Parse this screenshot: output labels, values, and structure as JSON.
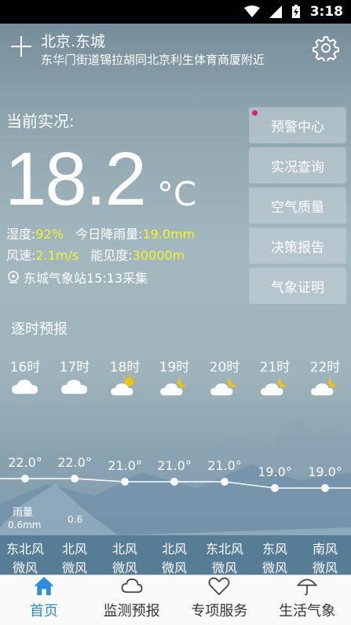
{
  "status_bar": {
    "time": "3:18"
  },
  "header": {
    "city": "北京.东城",
    "address": "东华门街道锡拉胡同北京利生体育商厦附近"
  },
  "current": {
    "label": "当前实况:",
    "temperature": "18.2",
    "unit": "°C",
    "humidity_label": "湿度:",
    "humidity": "92%",
    "rain_label": "今日降雨量:",
    "rain": "19.0mm",
    "wind_label": "风速:",
    "wind": "2.1m/s",
    "visibility_label": "能见度:",
    "visibility": "30000m",
    "station": "东城气象站15:13采集"
  },
  "side_buttons": [
    {
      "label": "预警中心"
    },
    {
      "label": "实况查询"
    },
    {
      "label": "空气质量"
    },
    {
      "label": "决策报告"
    },
    {
      "label": "气象证明"
    }
  ],
  "hourly": {
    "title": "逐时预报",
    "items": [
      {
        "hour": "16时",
        "icon": "cloudy-icon",
        "temp": "22.0°",
        "temp_value": 22.0,
        "wind_dir": "东北风",
        "wind_level": "微风"
      },
      {
        "hour": "17时",
        "icon": "cloudy-icon",
        "temp": "22.0°",
        "temp_value": 22.0,
        "wind_dir": "北风",
        "wind_level": "微风"
      },
      {
        "hour": "18时",
        "icon": "partly-cloudy-day-icon",
        "temp": "21.0°",
        "temp_value": 21.0,
        "wind_dir": "北风",
        "wind_level": "微风"
      },
      {
        "hour": "19时",
        "icon": "partly-cloudy-night-icon",
        "temp": "21.0°",
        "temp_value": 21.0,
        "wind_dir": "北风",
        "wind_level": "微风"
      },
      {
        "hour": "20时",
        "icon": "partly-cloudy-night-icon",
        "temp": "21.0°",
        "temp_value": 21.0,
        "wind_dir": "东北风",
        "wind_level": "微风"
      },
      {
        "hour": "21时",
        "icon": "partly-cloudy-night-icon",
        "temp": "19.0°",
        "temp_value": 19.0,
        "wind_dir": "东风",
        "wind_level": "微风"
      },
      {
        "hour": "22时",
        "icon": "partly-cloudy-night-icon",
        "temp": "19.0°",
        "temp_value": 19.0,
        "wind_dir": "南风",
        "wind_level": "微风"
      }
    ],
    "rain_label": "雨量",
    "rain_value": "0.6mm",
    "rain_value_2": "0.6"
  },
  "nav": [
    {
      "label": "首页",
      "icon": "home-icon",
      "active": true
    },
    {
      "label": "监测预报",
      "icon": "cloud-icon",
      "active": false
    },
    {
      "label": "专项服务",
      "icon": "heart-icon",
      "active": false
    },
    {
      "label": "生活气象",
      "icon": "umbrella-icon",
      "active": false
    }
  ]
}
